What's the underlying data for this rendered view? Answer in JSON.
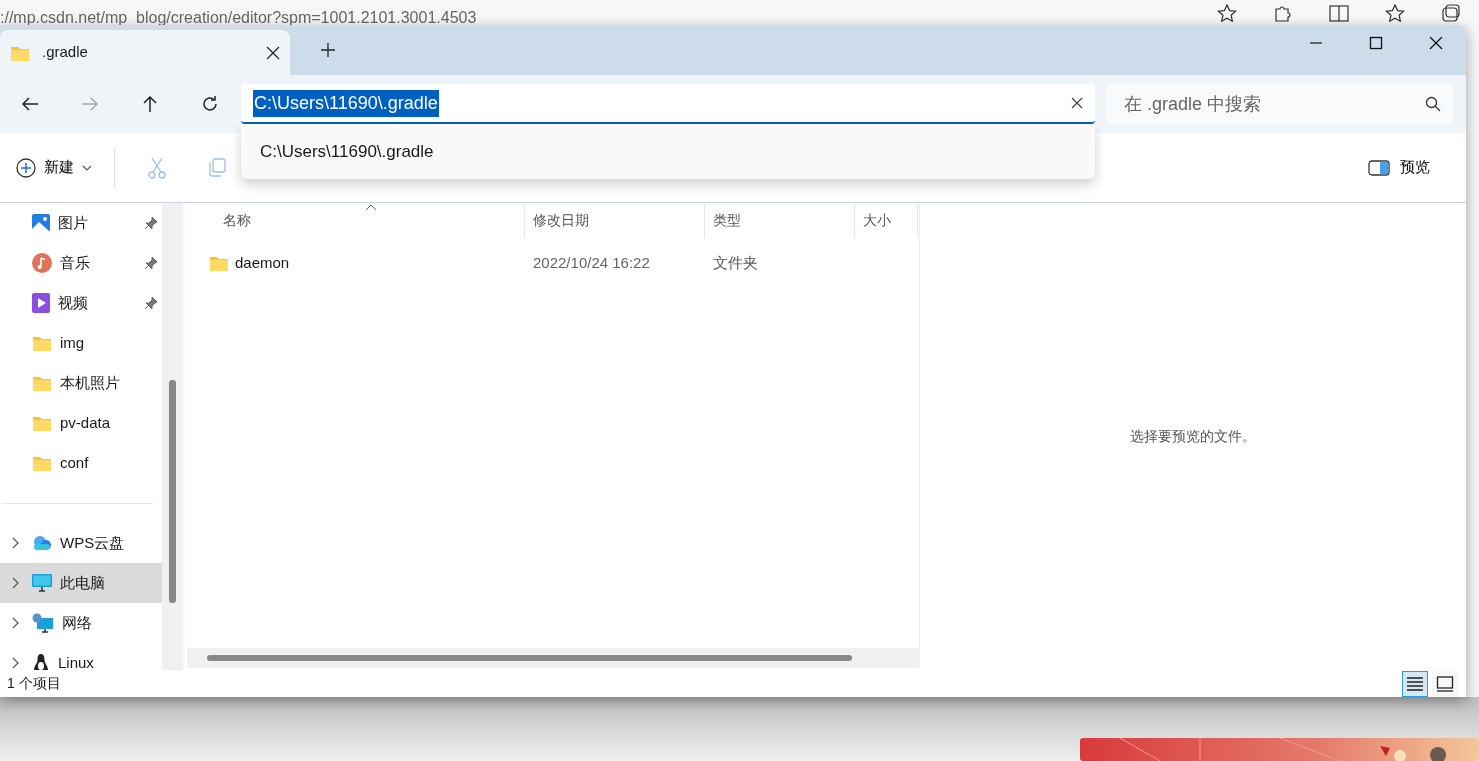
{
  "browser": {
    "address": "://mp.csdn.net/mp_blog/creation/editor?spm=1001.2101.3001.4503"
  },
  "window": {
    "tabs": [
      {
        "title": ".gradle",
        "selected": true
      }
    ]
  },
  "nav": [
    {
      "kind": "back",
      "disabled": false
    },
    {
      "kind": "forward",
      "disabled": true
    },
    {
      "kind": "up",
      "disabled": false
    },
    {
      "kind": "refresh",
      "disabled": false
    }
  ],
  "address_bar": {
    "value": "C:\\Users\\11690\\.gradle",
    "suggestions": [
      "C:\\Users\\11690\\.gradle"
    ]
  },
  "search": {
    "placeholder": "在 .gradle 中搜索"
  },
  "toolbar": {
    "new": "新建",
    "tools": [
      {
        "kind": "cut",
        "disabled": true
      },
      {
        "kind": "copy",
        "disabled": true
      }
    ],
    "preview": "预览"
  },
  "sidebar": {
    "quick_access": [
      {
        "label": "图片",
        "kind": "pictures",
        "pinned": true
      },
      {
        "label": "音乐",
        "kind": "music",
        "pinned": true
      },
      {
        "label": "视频",
        "kind": "videos",
        "pinned": true
      },
      {
        "label": "img",
        "kind": "folder",
        "pinned": false
      },
      {
        "label": "本机照片",
        "kind": "folder",
        "pinned": false
      },
      {
        "label": "pv-data",
        "kind": "folder",
        "pinned": false
      },
      {
        "label": "conf",
        "kind": "folder",
        "pinned": false
      }
    ],
    "places": [
      {
        "label": "WPS云盘",
        "kind": "cloud",
        "selected": false
      },
      {
        "label": "此电脑",
        "kind": "pc",
        "selected": true
      },
      {
        "label": "网络",
        "kind": "network",
        "selected": false
      },
      {
        "label": "Linux",
        "kind": "linux",
        "selected": false
      }
    ]
  },
  "table": {
    "columns": [
      {
        "label": "名称",
        "sorted": true
      },
      {
        "label": "修改日期",
        "sorted": false
      },
      {
        "label": "类型",
        "sorted": false
      },
      {
        "label": "大小",
        "sorted": false
      }
    ],
    "rows": [
      {
        "name": "daemon",
        "modified": "2022/10/24 16:22",
        "type": "文件夹"
      }
    ]
  },
  "preview_pane": {
    "message": "选择要预览的文件。"
  },
  "status_bar": {
    "count": "1 个项目",
    "views": [
      {
        "kind": "details",
        "selected": true
      },
      {
        "kind": "tiles",
        "selected": false
      }
    ]
  }
}
